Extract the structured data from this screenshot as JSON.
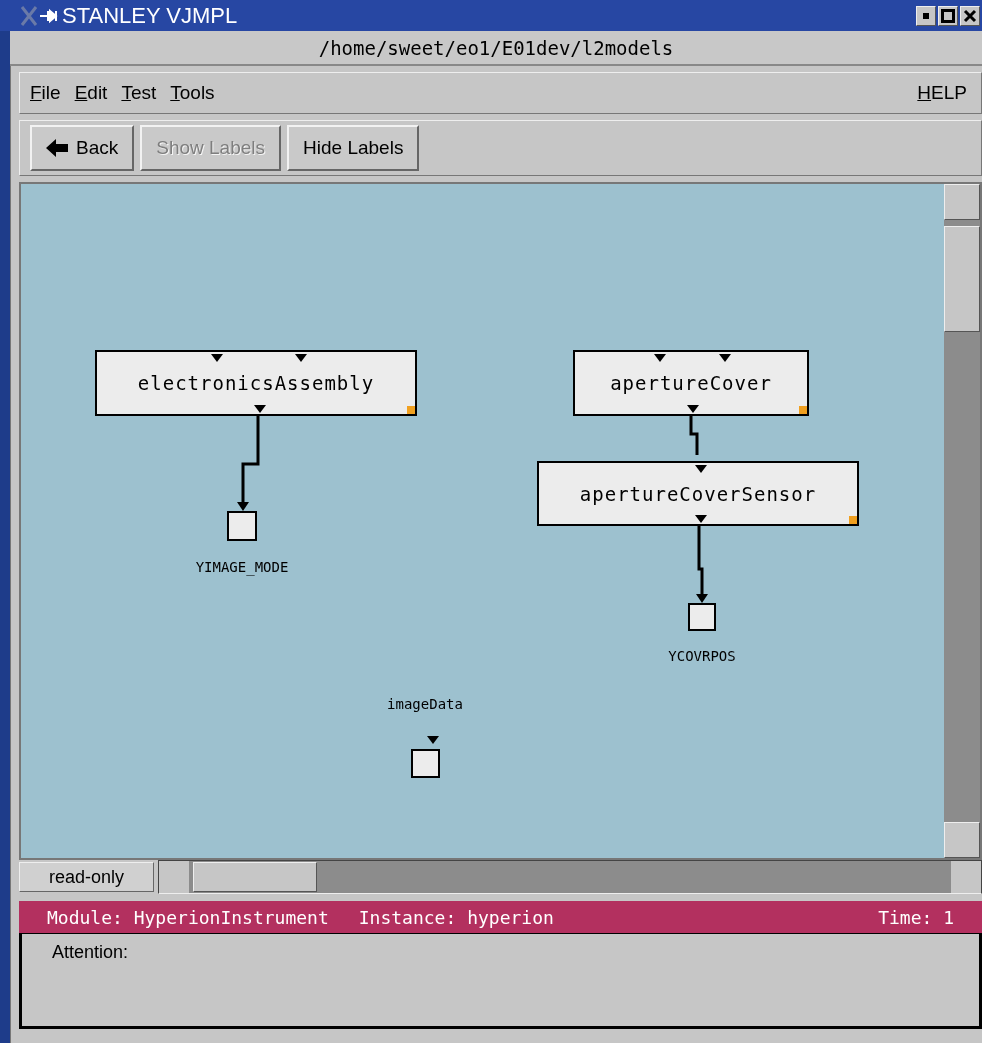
{
  "window": {
    "title": "STANLEY VJMPL"
  },
  "path": "/home/sweet/eo1/E01dev/l2models",
  "menu": [
    {
      "label": "File"
    },
    {
      "label": "Edit"
    },
    {
      "label": "Test"
    },
    {
      "label": "Tools"
    }
  ],
  "help": "HELP",
  "toolbar": [
    {
      "label": "Back",
      "kind": "back",
      "disabled": false
    },
    {
      "label": "Show Labels",
      "kind": "plain",
      "disabled": true
    },
    {
      "label": "Hide Labels",
      "kind": "plain",
      "disabled": false
    }
  ],
  "diagram": {
    "nodes": [
      {
        "kind": "module",
        "name": "electronicsAssembly"
      },
      {
        "kind": "module",
        "name": "apertureCover"
      },
      {
        "kind": "module",
        "name": "apertureCoverSensor"
      },
      {
        "kind": "variable",
        "name": "YIMAGE_MODE"
      },
      {
        "kind": "variable",
        "name": "YCOVRPOS"
      },
      {
        "kind": "variable",
        "name": "imageData"
      }
    ]
  },
  "mode": "read-only",
  "status": {
    "module": "Module: HyperionInstrument",
    "instance": "Instance: hyperion",
    "time": "Time: 1"
  },
  "attention": "Attention:"
}
